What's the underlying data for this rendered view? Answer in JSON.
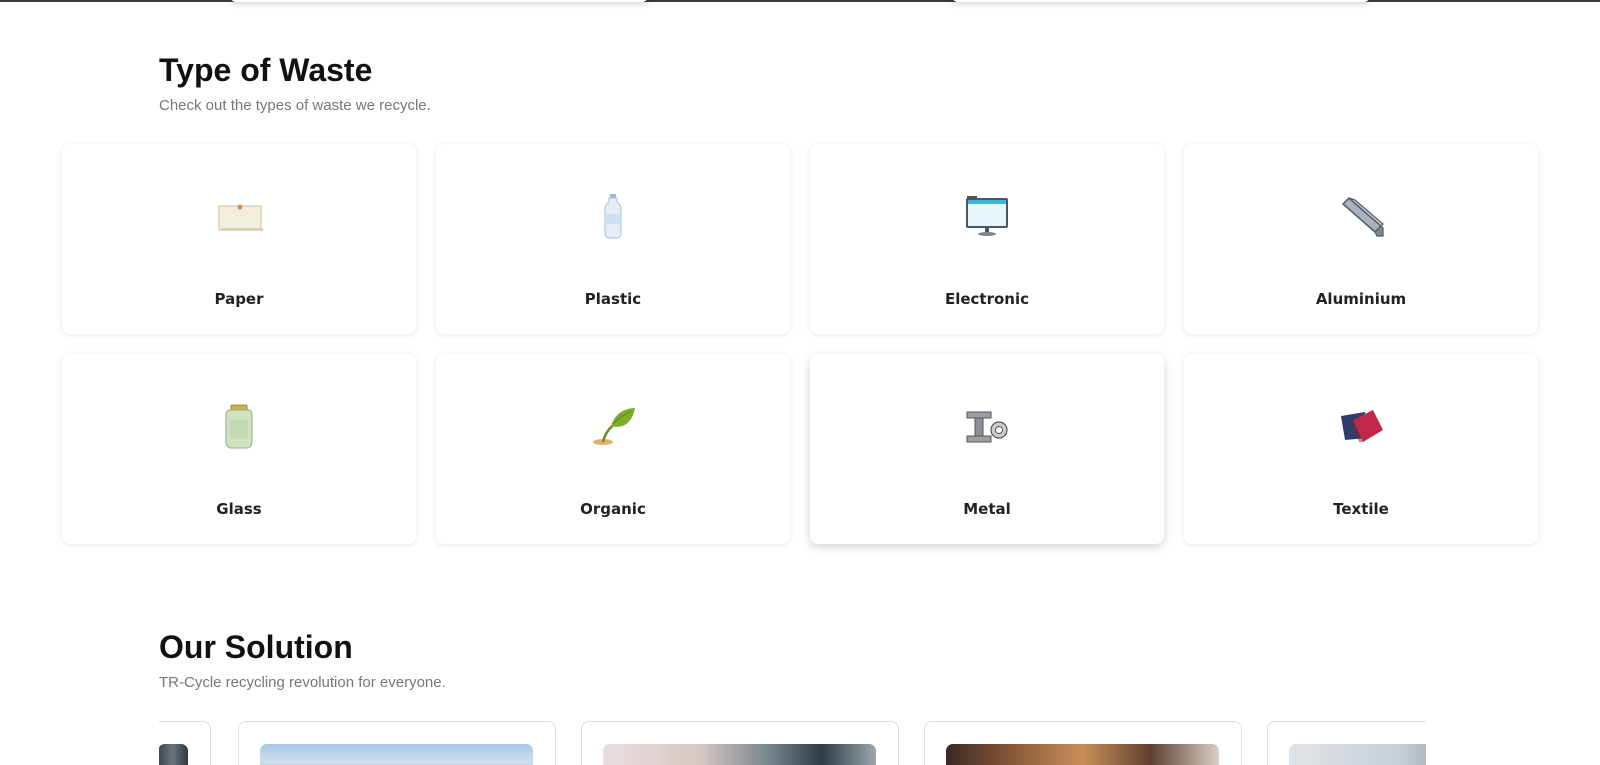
{
  "waste_section": {
    "title": "Type of Waste",
    "subtitle": "Check out the types of waste we recycle.",
    "items": [
      {
        "label": "Paper",
        "icon": "paper-icon"
      },
      {
        "label": "Plastic",
        "icon": "plastic-bottle-icon"
      },
      {
        "label": "Electronic",
        "icon": "monitor-icon"
      },
      {
        "label": "Aluminium",
        "icon": "aluminium-bar-icon"
      },
      {
        "label": "Glass",
        "icon": "glass-jar-icon"
      },
      {
        "label": "Organic",
        "icon": "leaf-sprout-icon"
      },
      {
        "label": "Metal",
        "icon": "metal-beam-icon"
      },
      {
        "label": "Textile",
        "icon": "fabric-icon"
      }
    ]
  },
  "solution_section": {
    "title": "Our Solution",
    "subtitle": "TR-Cycle recycling revolution for everyone."
  },
  "colors": {
    "heading": "#111111",
    "subtitle": "#777777",
    "card_label": "#222222",
    "card_background": "#ffffff"
  }
}
